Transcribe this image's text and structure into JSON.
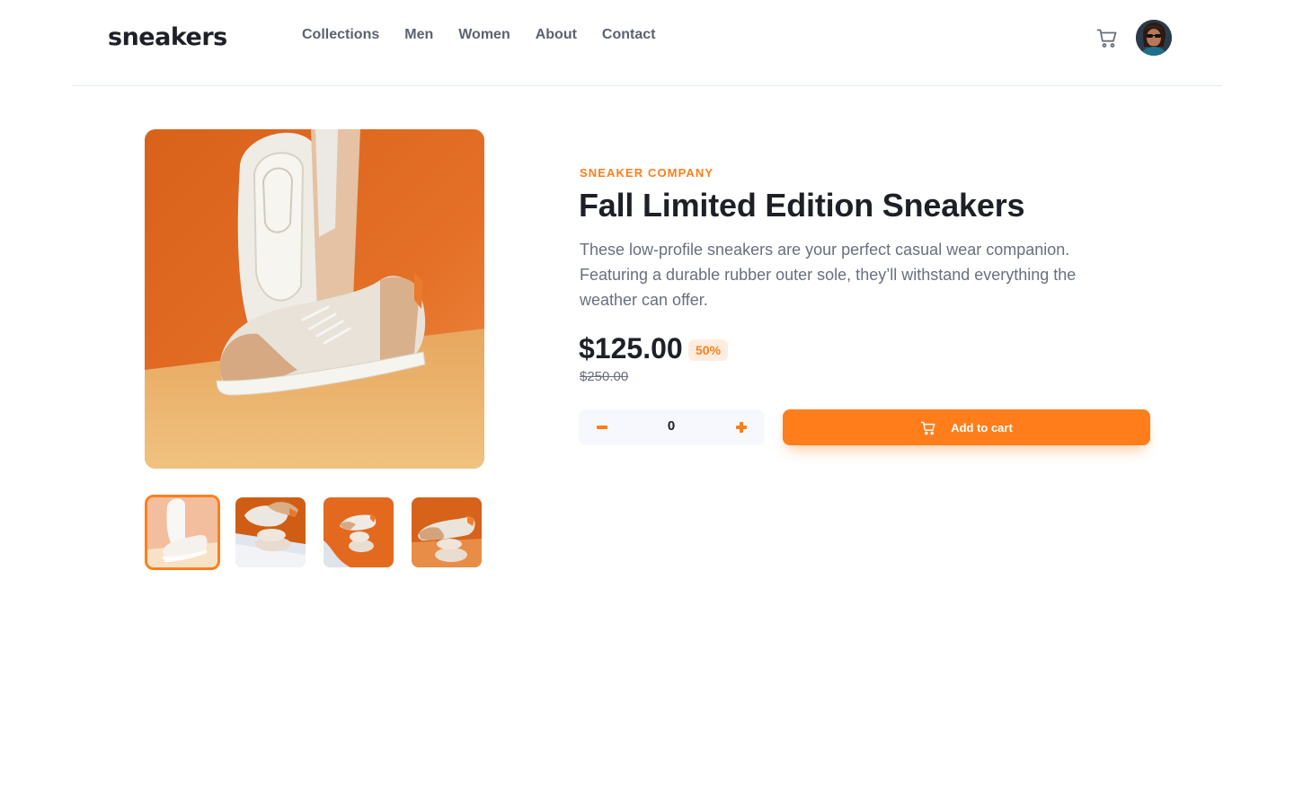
{
  "header": {
    "logo": "sneakers",
    "nav": [
      "Collections",
      "Men",
      "Women",
      "About",
      "Contact"
    ],
    "cart_icon": "cart-icon",
    "avatar_icon": "user-avatar"
  },
  "gallery": {
    "main_image": "sneaker-photo-main",
    "thumbnails": [
      "thumbnail-1",
      "thumbnail-2",
      "thumbnail-3",
      "thumbnail-4"
    ],
    "active_thumbnail_index": 0
  },
  "product": {
    "company": "SNEAKER COMPANY",
    "title": "Fall Limited Edition Sneakers",
    "description": "These low-profile sneakers are your perfect casual wear companion. Featuring a durable rubber outer sole, they’ll withstand everything the weather can offer.",
    "price": "$125.00",
    "discount": "50%",
    "original_price": "$250.00"
  },
  "cart_controls": {
    "quantity": "0",
    "minus_icon": "minus-icon",
    "plus_icon": "plus-icon",
    "add_label": "Add to cart"
  },
  "colors": {
    "accent": "#ff7e1b",
    "accent_pale": "#ffede0",
    "text_dark": "#1d2026",
    "text_muted": "#68707d",
    "qty_bg": "#f6f8fd"
  }
}
